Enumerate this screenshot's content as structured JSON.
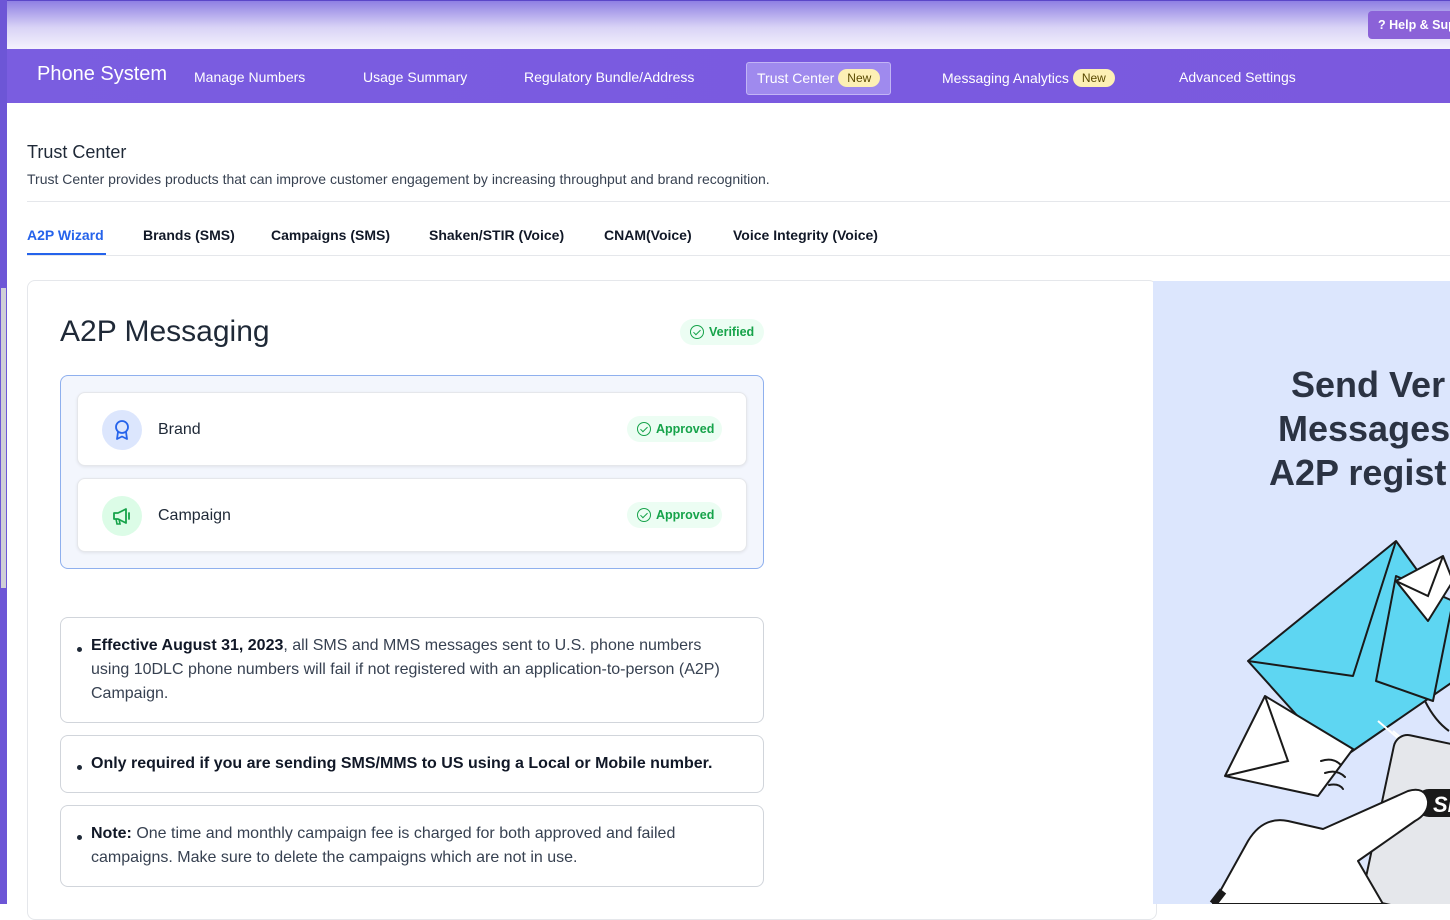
{
  "topbar": {
    "help_label": "Help & Support"
  },
  "navbar": {
    "brand": "Phone System",
    "items": [
      {
        "label": "Manage Numbers"
      },
      {
        "label": "Usage Summary"
      },
      {
        "label": "Regulatory Bundle/Address"
      },
      {
        "label": "Trust Center",
        "badge": "New",
        "active": true
      },
      {
        "label": "Messaging Analytics",
        "badge": "New"
      },
      {
        "label": "Advanced Settings"
      }
    ]
  },
  "page": {
    "title": "Trust Center",
    "description": "Trust Center provides products that can improve customer engagement by increasing throughput and brand recognition."
  },
  "tabs": [
    {
      "label": "A2P Wizard",
      "active": true
    },
    {
      "label": "Brands (SMS)"
    },
    {
      "label": "Campaigns (SMS)"
    },
    {
      "label": "Shaken/STIR (Voice)"
    },
    {
      "label": "CNAM(Voice)"
    },
    {
      "label": "Voice Integrity (Voice)"
    }
  ],
  "a2p": {
    "title": "A2P Messaging",
    "status": "Verified",
    "steps": [
      {
        "label": "Brand",
        "status": "Approved",
        "icon": "award-icon"
      },
      {
        "label": "Campaign",
        "status": "Approved",
        "icon": "megaphone-icon"
      }
    ]
  },
  "notes": {
    "n1_bold": "Effective August 31, 2023",
    "n1_text": ", all SMS and MMS messages sent to U.S. phone numbers using 10DLC phone numbers will fail if not registered with an application-to-person (A2P) Campaign.",
    "n2_bold": "Only required if you are sending SMS/MMS to US using a Local or Mobile number.",
    "n3_bold": "Note:",
    "n3_text": " One time and monthly campaign fee is charged for both approved and failed campaigns. Make sure to delete the campaigns which are not in use."
  },
  "promo": {
    "line1": "Send Ver",
    "line2": "Messages",
    "line3": "A2P regist",
    "sms_label": "SI"
  },
  "colors": {
    "accent": "#7a5de0",
    "link": "#2563eb",
    "success": "#16a34a",
    "promo_bg": "#dce6fd"
  }
}
